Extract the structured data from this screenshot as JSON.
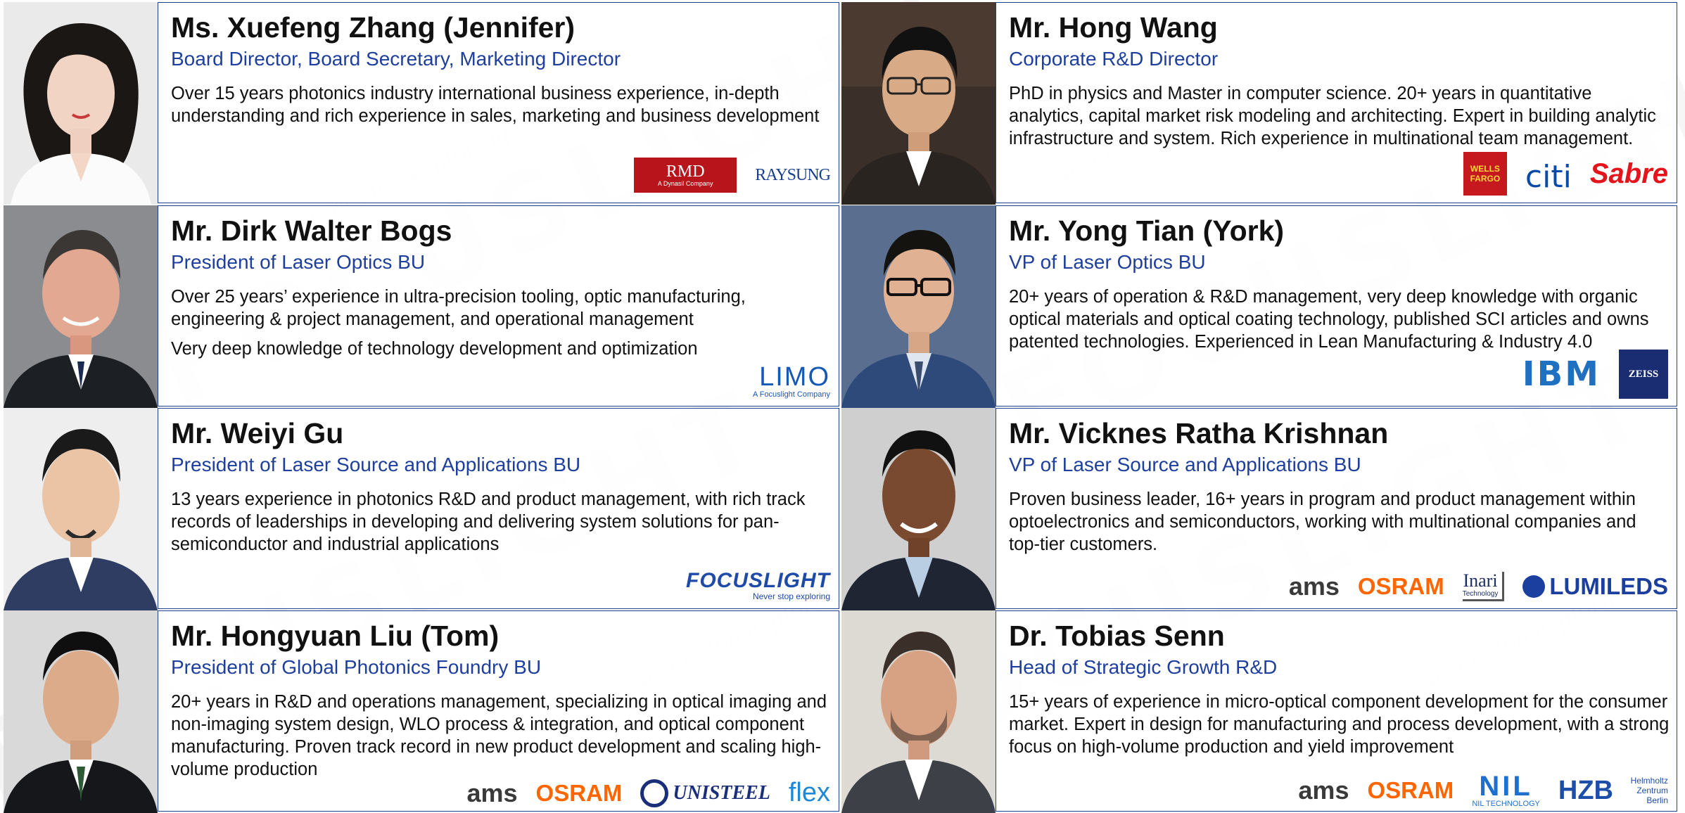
{
  "watermark": {
    "brand": "FOCUSLIGHT",
    "tagline": "Never stop exploring"
  },
  "colors": {
    "title_blue": "#1f3f9f",
    "border_blue": "#1f3f8f",
    "osram_orange": "#ff6600",
    "ibm_blue": "#1f70c1"
  },
  "people": [
    {
      "name": "Ms. Xuefeng Zhang (Jennifer)",
      "title": "Board Director, Board Secretary, Marketing Director",
      "desc": [
        "Over 15 years photonics industry international business experience, in-depth understanding and rich experience in sales, marketing and business development"
      ],
      "logos": [
        {
          "name": "rmd-logo",
          "text": "RMD",
          "sub": "A Dynasil Company"
        },
        {
          "name": "raysung-logo",
          "text": "RAYSUNG"
        }
      ]
    },
    {
      "name": "Mr. Hong Wang",
      "title": "Corporate R&D Director",
      "desc": [
        "PhD in physics and Master in computer science. 20+ years in quantitative analytics, capital market risk modeling and architecting. Expert in building analytic infrastructure and system. Rich experience in multinational team management."
      ],
      "logos": [
        {
          "name": "wells-fargo-logo",
          "text": "WELLS FARGO"
        },
        {
          "name": "citi-logo",
          "text": "citi"
        },
        {
          "name": "sabre-logo",
          "text": "Sabre"
        }
      ]
    },
    {
      "name": "Mr. Dirk Walter Bogs",
      "title": "President of Laser Optics BU",
      "desc": [
        "Over 25 years’ experience in ultra-precision tooling, optic manufacturing, engineering & project management, and operational management",
        "Very deep knowledge of technology development and optimization"
      ],
      "logos": [
        {
          "name": "limo-logo",
          "text": "LIMO",
          "sub": "A Focuslight Company"
        }
      ]
    },
    {
      "name": "Mr. Yong Tian (York)",
      "title": "VP of Laser Optics BU",
      "desc": [
        "20+ years of operation & R&D management, very deep knowledge with organic optical materials and optical coating technology, published SCI articles and owns patented technologies. Experienced in Lean Manufacturing & Industry 4.0"
      ],
      "logos": [
        {
          "name": "ibm-logo",
          "text": "IBM"
        },
        {
          "name": "zeiss-logo",
          "text": "ZEISS"
        }
      ]
    },
    {
      "name": "Mr. Weiyi Gu",
      "title": "President of Laser Source and Applications BU",
      "desc": [
        "13 years experience in photonics R&D and product management, with rich track records of leaderships in developing and delivering system solutions for pan-semiconductor and industrial applications"
      ],
      "logos": [
        {
          "name": "focuslight-logo",
          "text": "FOCUSLIGHT",
          "sub": "Never stop exploring"
        }
      ]
    },
    {
      "name": "Mr. Vicknes Ratha Krishnan",
      "title": "VP of Laser Source and Applications BU",
      "desc": [
        "Proven business leader, 16+ years in program and product management within optoelectronics and semiconductors, working with multinational companies and top-tier customers."
      ],
      "logos": [
        {
          "name": "ams-logo",
          "text": "ams"
        },
        {
          "name": "osram-logo",
          "text": "OSRAM"
        },
        {
          "name": "inari-logo",
          "text": "Inari",
          "sub": "Technology"
        },
        {
          "name": "lumileds-logo",
          "text": "LUMILEDS"
        }
      ]
    },
    {
      "name": "Mr. Hongyuan Liu (Tom)",
      "title": "President of Global Photonics Foundry BU",
      "desc": [
        "20+ years in R&D and operations management, specializing in optical imaging and non-imaging system design, WLO process & integration, and optical component manufacturing. Proven track record in new product development and scaling high-volume production"
      ],
      "logos": [
        {
          "name": "ams-logo",
          "text": "ams"
        },
        {
          "name": "osram-logo",
          "text": "OSRAM"
        },
        {
          "name": "unisteel-logo",
          "text": "UNISTEEL"
        },
        {
          "name": "flex-logo",
          "text": "flex"
        }
      ]
    },
    {
      "name": "Dr. Tobias Senn",
      "title": "Head of Strategic Growth R&D",
      "desc": [
        "15+ years of experience in micro-optical component development for the consumer market. Expert in design for manufacturing and process development, with a strong focus on high-volume production and yield improvement"
      ],
      "logos": [
        {
          "name": "ams-logo",
          "text": "ams"
        },
        {
          "name": "osram-logo",
          "text": "OSRAM"
        },
        {
          "name": "nil-technology-logo",
          "text": "NIL",
          "sub": "NIL TECHNOLOGY"
        },
        {
          "name": "hzb-logo",
          "text": "HZB",
          "sub": "Helmholtz Zentrum Berlin"
        }
      ]
    }
  ]
}
